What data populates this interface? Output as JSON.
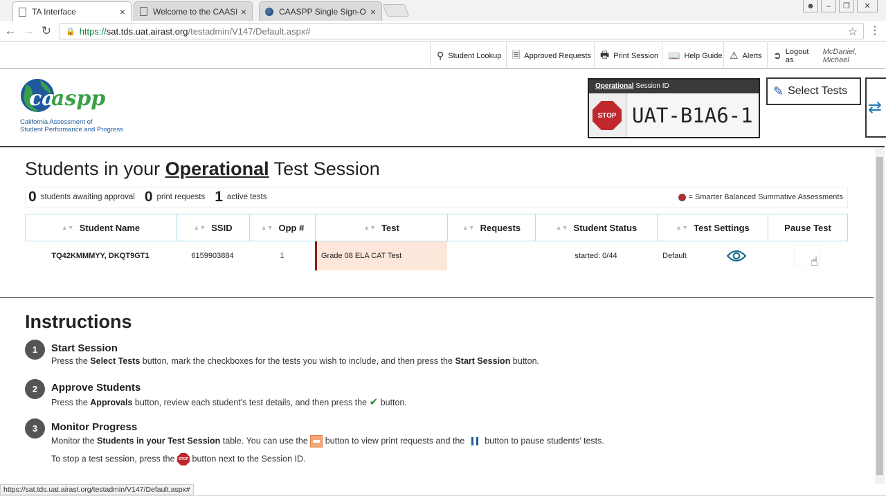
{
  "browser": {
    "tabs": [
      {
        "label": "TA Interface",
        "icon": "page-icon",
        "active": true
      },
      {
        "label": "Welcome to the CAASPP",
        "icon": "page-icon",
        "active": false
      },
      {
        "label": "CAASPP Single Sign-On",
        "icon": "globe-icon",
        "active": false
      }
    ],
    "close_glyph": "×",
    "url": {
      "scheme": "https://",
      "host": "sat.tds.uat.airast.org",
      "path": "/testadmin/V147/Default.aspx#"
    },
    "status_url": "https://sat.tds.uat.airast.org/testadmin/V147/Default.aspx#"
  },
  "topnav": {
    "student_lookup": "Student Lookup",
    "approved_requests": "Approved Requests",
    "print_session": "Print Session",
    "help_guide": "Help Guide",
    "alerts": "Alerts",
    "logout_label": "Logout as",
    "user": "McDaniel, Michael"
  },
  "header": {
    "logo_text": "caaspp",
    "logo_sub_line1": "California Assessment of",
    "logo_sub_line2": "Student Performance and Progress",
    "session_type": "Operational",
    "session_label": "Session ID",
    "stop_label": "STOP",
    "session_id": "UAT-B1A6-1",
    "select_tests": "Select Tests"
  },
  "students": {
    "title_prefix": "Students in your ",
    "title_highlight": "Operational",
    "title_suffix": " Test Session",
    "counts": {
      "awaiting_num": "0",
      "awaiting_label": "students awaiting approval",
      "print_num": "0",
      "print_label": "print requests",
      "active_num": "1",
      "active_label": "active tests"
    },
    "legend": "= Smarter Balanced Summative Assessments",
    "columns": [
      "Student Name",
      "SSID",
      "Opp #",
      "Test",
      "Requests",
      "Student Status",
      "Test Settings",
      "Pause Test"
    ],
    "rows": [
      {
        "name": "TQ42KMMMYY, DKQT9GT1",
        "ssid": "6159903884",
        "opp": "1",
        "test": "Grade 08 ELA CAT Test",
        "requests": "",
        "status": "started: 0/44",
        "settings": "Default"
      }
    ]
  },
  "instructions": {
    "title": "Instructions",
    "steps": [
      {
        "num": "1",
        "title": "Start Session",
        "t1": "Press the ",
        "b1": "Select Tests",
        "t2": " button, mark the checkboxes for the tests you wish to include, and then press the ",
        "b2": "Start Session",
        "t3": " button."
      },
      {
        "num": "2",
        "title": "Approve Students",
        "t1": "Press the ",
        "b1": "Approvals",
        "t2": " button, review each student's test details, and then press the ",
        "t3": " button."
      },
      {
        "num": "3",
        "title": "Monitor Progress",
        "t1": "Monitor the ",
        "b1": "Students in your Test Session",
        "t2": " table. You can use the ",
        "t3": " button to view print requests and the ",
        "t4": " button to pause students' tests.",
        "l2a": "To stop a test session, press the ",
        "l2b": " button next to the Session ID."
      }
    ]
  },
  "colors": {
    "brand_blue": "#1f5a9e",
    "brand_green": "#3aa047",
    "stop_red": "#c0272d",
    "test_cell": "#fde6da",
    "grid_border": "#aee0ec"
  }
}
